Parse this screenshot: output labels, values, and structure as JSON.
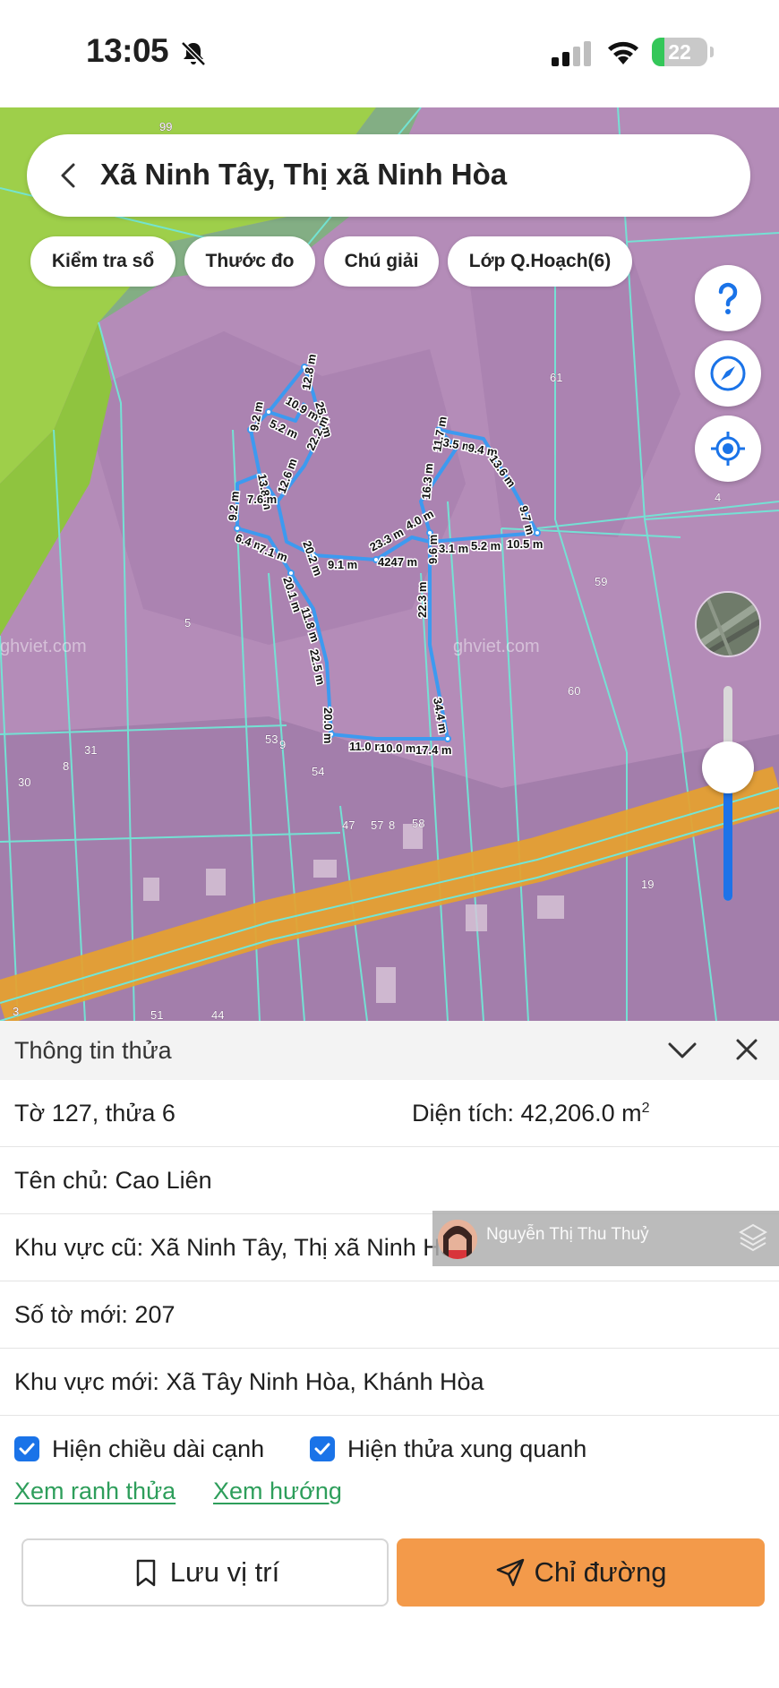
{
  "status_bar": {
    "time": "13:05",
    "battery_level": "22",
    "battery_fraction": 0.22,
    "silent_mode": true
  },
  "map": {
    "search_title": "Xã Ninh Tây, Thị xã Ninh Hòa",
    "chips": [
      "Kiểm tra sổ",
      "Thước đo",
      "Chú giải",
      "Lớp Q.Hoạch(6)"
    ],
    "watermark": "ghviet.com",
    "parcel_numbers": [
      "99",
      "61",
      "4",
      "59",
      "60",
      "5",
      "31",
      "8",
      "30",
      "53",
      "9",
      "54",
      "47",
      "57",
      "8",
      "58",
      "19",
      "3",
      "51",
      "44"
    ],
    "edge_labels": [
      "12.8 m",
      "10.9 m",
      "5.2 m",
      "9.2 m",
      "25.5 m",
      "22.2 m",
      "13.8 m",
      "7.6 m",
      "12.6 m",
      "9.2 m",
      "6.4 m",
      "7.1 m",
      "20.2 m",
      "9.1 m",
      "23.3 m",
      "4.0 m",
      "16.3 m",
      "11.7 m",
      "3.5 m",
      "9.4 m",
      "13.6 m",
      "9.7 m",
      "4247 m",
      "9.6 m",
      "3.1 m",
      "5.2 m",
      "10.5 m",
      "20.1 m",
      "11.8 m",
      "22.5 m",
      "22.3 m",
      "20.0 m",
      "11.0 m",
      "10.0 m",
      "17.4 m",
      "34.4 m"
    ],
    "zoom_level": 0.62,
    "colors": {
      "planning_fill": "#b48cb8",
      "agri_green": "#9ecf4a",
      "parcel_lines": "#72e6d6",
      "boundary": "#3d9af0",
      "road": "#e6a12e"
    }
  },
  "panel": {
    "title": "Thông tin thửa",
    "sheet_parcel": "Tờ 127, thửa 6",
    "area_label": "Diện tích: 42,206.0 m",
    "area_sup": "2",
    "owner": "Tên chủ: Cao Liên",
    "old_area": "Khu vực cũ: Xã Ninh Tây, Thị xã Ninh Hòa",
    "new_sheet": "Số tờ mới: 207",
    "new_area": "Khu vực mới: Xã Tây Ninh Hòa, Khánh Hòa",
    "check_edges": "Hiện chiều dài cạnh",
    "check_edges_checked": true,
    "check_neighbors": "Hiện thửa xung quanh",
    "check_neighbors_checked": true,
    "link_boundary": "Xem ranh thửa",
    "link_direction": "Xem hướng",
    "btn_save": "Lưu vị trí",
    "btn_route": "Chỉ đường",
    "overlay_name": "Nguyễn Thị Thu Thuỷ"
  }
}
